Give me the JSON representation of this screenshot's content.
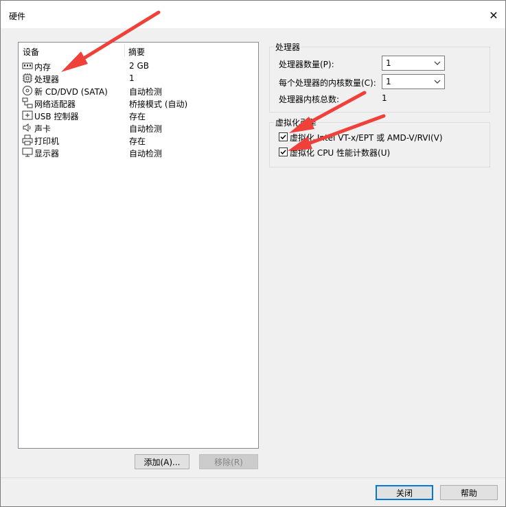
{
  "window": {
    "title": "硬件"
  },
  "devices": {
    "col_device": "设备",
    "col_summary": "摘要",
    "items": [
      {
        "name": "内存",
        "summary": "2 GB",
        "icon": "memory-icon"
      },
      {
        "name": "处理器",
        "summary": "1",
        "icon": "processor-icon"
      },
      {
        "name": "新 CD/DVD (SATA)",
        "summary": "自动检测",
        "icon": "cd-dvd-icon"
      },
      {
        "name": "网络适配器",
        "summary": "桥接模式 (自动)",
        "icon": "network-adapter-icon"
      },
      {
        "name": "USB 控制器",
        "summary": "存在",
        "icon": "usb-icon"
      },
      {
        "name": "声卡",
        "summary": "自动检测",
        "icon": "speaker-icon"
      },
      {
        "name": "打印机",
        "summary": "存在",
        "icon": "printer-icon"
      },
      {
        "name": "显示器",
        "summary": "自动检测",
        "icon": "monitor-icon"
      }
    ],
    "add_button": "添加(A)...",
    "remove_button": "移除(R)"
  },
  "processor": {
    "group_title": "处理器",
    "count_label": "处理器数量(P):",
    "count_value": "1",
    "cores_label": "每个处理器的内核数量(C):",
    "cores_value": "1",
    "total_label": "处理器内核总数:",
    "total_value": "1"
  },
  "virtualization": {
    "group_title": "虚拟化引擎",
    "vtx_label": "虚拟化 Intel VT-x/EPT 或 AMD-V/RVI(V)",
    "vtx_checked": true,
    "cpu_counters_label": "虚拟化 CPU 性能计数器(U)",
    "cpu_counters_checked": true
  },
  "footer": {
    "close_button": "关闭",
    "help_button": "帮助"
  },
  "colors": {
    "arrow": "#f0403a",
    "accent": "#0078d7"
  }
}
